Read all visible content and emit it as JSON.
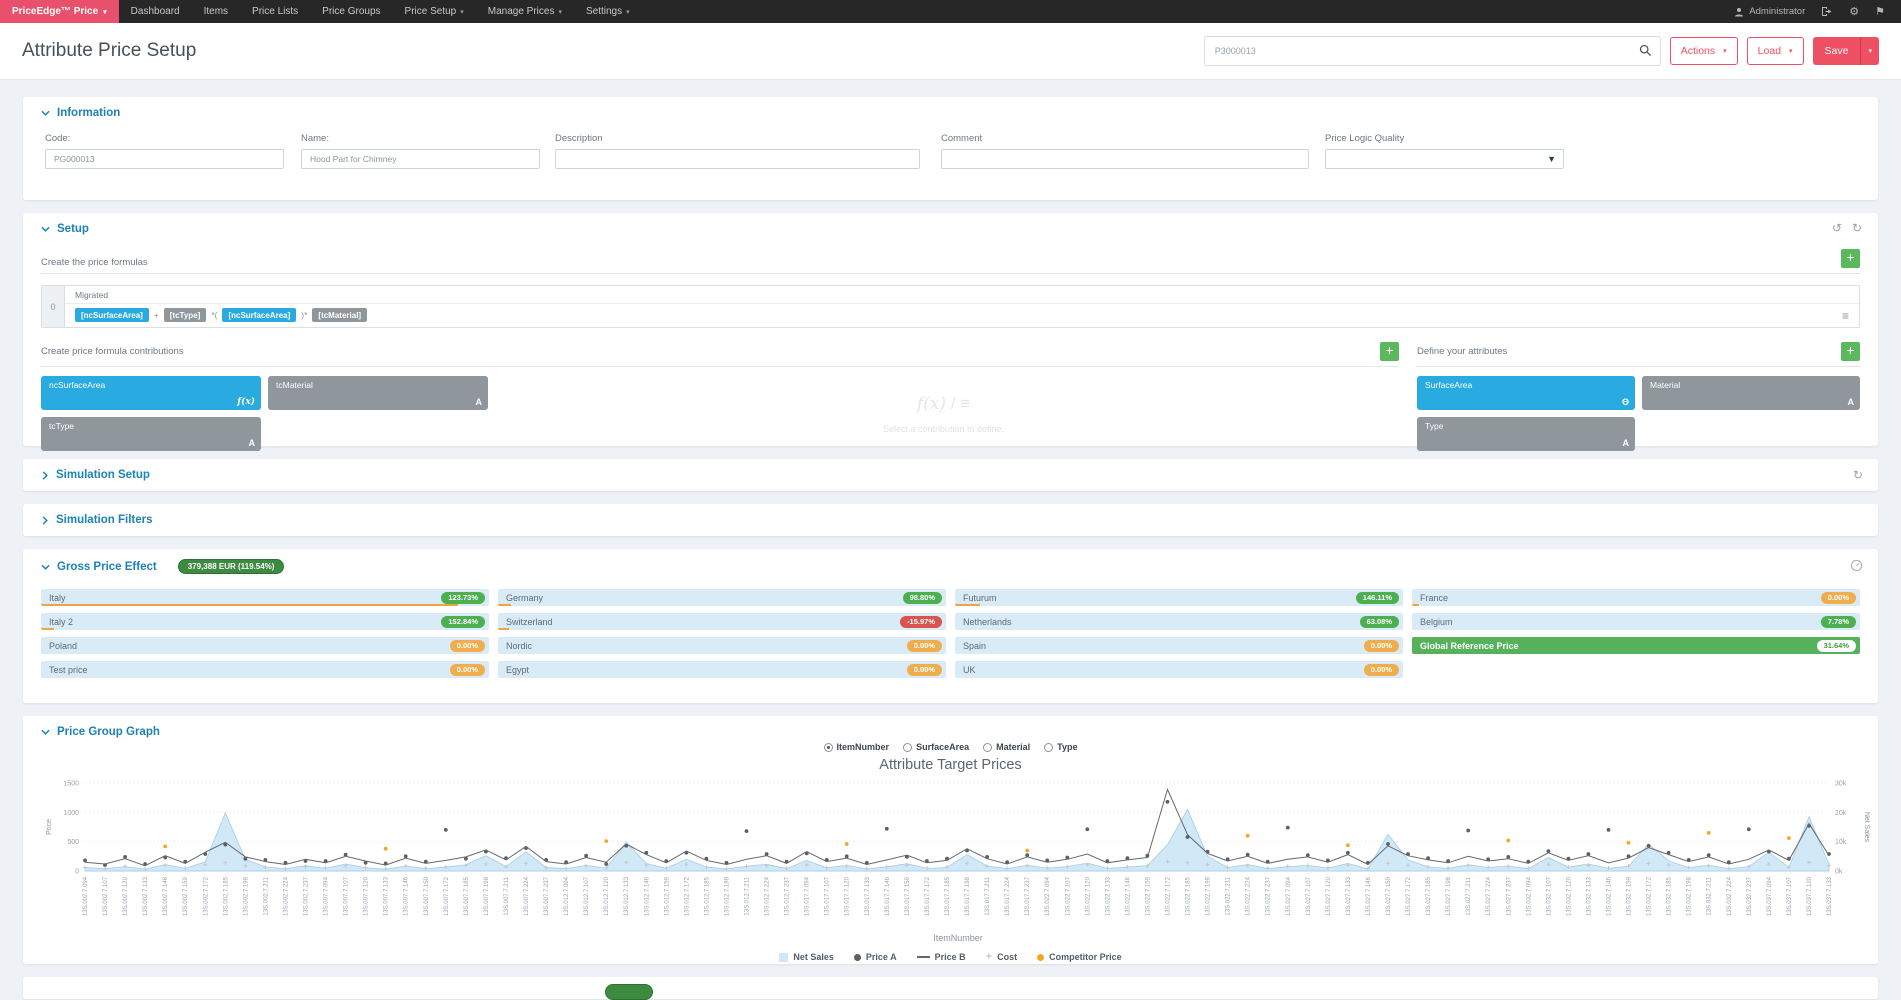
{
  "colors": {
    "accent": "#ee4f63",
    "brand": "#e8506b",
    "header_blue": "#1d82b5",
    "green": "#4caf50",
    "dark_green_badge": "#3d8b40",
    "orange": "#f0ad4e",
    "red": "#d9534f",
    "card_blue": "#29abe2",
    "card_gray": "#8f969c",
    "row_blue": "#d9ebf7",
    "global_green": "#56b25a",
    "bar_orange": "#f0a43f"
  },
  "navbar": {
    "brand": "PriceEdge™ Price",
    "items": [
      {
        "label": "Dashboard",
        "caret": false
      },
      {
        "label": "Items",
        "caret": false
      },
      {
        "label": "Price Lists",
        "caret": false
      },
      {
        "label": "Price Groups",
        "caret": false
      },
      {
        "label": "Price Setup",
        "caret": true
      },
      {
        "label": "Manage Prices",
        "caret": true
      },
      {
        "label": "Settings",
        "caret": true
      }
    ],
    "user": "Administrator"
  },
  "header": {
    "title": "Attribute Price Setup",
    "search_value": "P3000013",
    "actions_label": "Actions",
    "load_label": "Load",
    "save_label": "Save"
  },
  "information": {
    "title": "Information",
    "fields": [
      {
        "label": "Code:",
        "value": "PG000013",
        "type": "input"
      },
      {
        "label": "Name:",
        "value": "Hood Part for Chimney",
        "type": "input"
      },
      {
        "label": "Description",
        "value": "",
        "type": "input"
      },
      {
        "label": "Comment",
        "value": "",
        "type": "input"
      },
      {
        "label": "Price Logic Quality",
        "value": "",
        "type": "select"
      }
    ]
  },
  "setup": {
    "title": "Setup",
    "formulas_label": "Create the price formulas",
    "formula_index": "0",
    "formula_name": "Migrated",
    "formula_tokens": [
      {
        "kind": "chip",
        "style": "blue",
        "label": "[ncSurfaceArea]"
      },
      {
        "kind": "op",
        "label": "+"
      },
      {
        "kind": "chip",
        "style": "gray",
        "label": "[tcType]"
      },
      {
        "kind": "op",
        "label": "*("
      },
      {
        "kind": "chip",
        "style": "blue",
        "label": "[ncSurfaceArea]"
      },
      {
        "kind": "op",
        "label": ")*"
      },
      {
        "kind": "chip",
        "style": "gray",
        "label": "[tcMaterial]"
      }
    ],
    "contributions_label": "Create price formula contributions",
    "contribution_cards": [
      {
        "label": "ncSurfaceArea",
        "variant": "blue",
        "icon": "f(x)",
        "icon_name": "formula-icon"
      },
      {
        "label": "tcMaterial",
        "variant": "gray",
        "icon": "A",
        "icon_name": "text-attribute-icon"
      },
      {
        "label": "tcType",
        "variant": "gray",
        "icon": "A",
        "icon_name": "text-attribute-icon"
      }
    ],
    "definition_hint": "Select a contribution to define.",
    "definition_icons": "f(x) / ≡",
    "attributes_label": "Define your attributes",
    "attribute_cards": [
      {
        "label": "SurfaceArea",
        "variant": "blue",
        "icon": "Θ",
        "icon_name": "numeric-attribute-icon"
      },
      {
        "label": "Material",
        "variant": "gray",
        "icon": "A",
        "icon_name": "text-attribute-icon"
      },
      {
        "label": "Type",
        "variant": "gray",
        "icon": "A",
        "icon_name": "text-attribute-icon"
      }
    ]
  },
  "simulation_setup": {
    "title": "Simulation Setup"
  },
  "simulation_filters": {
    "title": "Simulation Filters"
  },
  "gross_price_effect": {
    "title": "Gross Price Effect",
    "total_badge": "379,388 EUR (119.54%)",
    "columns": [
      [
        {
          "name": "Italy",
          "badge": "123.73%",
          "tone": "green",
          "bar": 0.93
        },
        {
          "name": "Italy 2",
          "badge": "152.84%",
          "tone": "green",
          "bar": 0.03
        },
        {
          "name": "Poland",
          "badge": "0.00%",
          "tone": "orange",
          "bar": 0
        },
        {
          "name": "Test price",
          "badge": "0.00%",
          "tone": "orange",
          "bar": 0
        }
      ],
      [
        {
          "name": "Germany",
          "badge": "98.80%",
          "tone": "green",
          "bar": 0.03
        },
        {
          "name": "Switzerland",
          "badge": "-15.97%",
          "tone": "red",
          "bar": 0.025
        },
        {
          "name": "Nordic",
          "badge": "0.00%",
          "tone": "orange",
          "bar": 0
        },
        {
          "name": "Egypt",
          "badge": "0.00%",
          "tone": "orange",
          "bar": 0
        }
      ],
      [
        {
          "name": "Futurum",
          "badge": "146.11%",
          "tone": "green",
          "bar": 0.055
        },
        {
          "name": "Netherlands",
          "badge": "63.08%",
          "tone": "green",
          "bar": 0
        },
        {
          "name": "Spain",
          "badge": "0.00%",
          "tone": "orange",
          "bar": 0
        },
        {
          "name": "UK",
          "badge": "0.00%",
          "tone": "orange",
          "bar": 0
        }
      ],
      [
        {
          "name": "France",
          "badge": "0.00%",
          "tone": "orange",
          "bar": 0.015
        },
        {
          "name": "Belgium",
          "badge": "7.78%",
          "tone": "green",
          "bar": 0
        },
        {
          "name": "Global Reference Price",
          "badge": "31.64%",
          "tone": "global",
          "bar": 0
        }
      ]
    ]
  },
  "price_group_graph": {
    "title": "Price Group Graph",
    "radios": [
      {
        "label": "ItemNumber",
        "selected": true
      },
      {
        "label": "SurfaceArea",
        "selected": false
      },
      {
        "label": "Material",
        "selected": false
      },
      {
        "label": "Type",
        "selected": false
      }
    ],
    "chart_data": {
      "type": "line",
      "title": "Attribute Target Prices",
      "xlabel": "ItemNumber",
      "ylabel_left": "Price",
      "ylabel_right": "Net Sales",
      "ylim_left": [
        0,
        1500
      ],
      "ylim_right": [
        0,
        30000
      ],
      "yticks_left": [
        0,
        500,
        1000,
        1500
      ],
      "yticks_right": [
        "0k",
        "10k",
        "20k",
        "30k"
      ],
      "grid": true,
      "legend_position": "bottom",
      "categories": [
        "13S.002.7.094",
        "13S.002.7.107",
        "13S.002.7.120",
        "13S.002.7.133",
        "13S.002.7.146",
        "13S.002.7.159",
        "13S.002.7.172",
        "13S.002.7.185",
        "13S.002.7.198",
        "13S.002.7.211",
        "13S.002.7.224",
        "13S.002.7.237",
        "13S.007.7.094",
        "13S.007.7.107",
        "13S.007.7.120",
        "13S.007.7.133",
        "13S.007.7.146",
        "13S.007.7.159",
        "13S.007.7.172",
        "13S.007.7.185",
        "13S.007.7.198",
        "13S.007.7.211",
        "13S.007.7.224",
        "13S.007.7.237",
        "13S.012.7.094",
        "13S.012.7.107",
        "13S.012.7.120",
        "13S.012.7.133",
        "13S.012.7.146",
        "13S.012.7.159",
        "13S.012.7.172",
        "13S.012.7.185",
        "13S.012.7.198",
        "13S.012.7.211",
        "13S.012.7.224",
        "13S.012.7.237",
        "13S.017.7.094",
        "13S.017.7.107",
        "13S.017.7.120",
        "13S.017.7.133",
        "13S.017.7.146",
        "13S.017.7.159",
        "13S.017.7.172",
        "13S.017.7.185",
        "13S.017.7.198",
        "13S.017.7.211",
        "13S.017.7.224",
        "13S.017.7.237",
        "13S.022.7.094",
        "13S.022.7.107",
        "13S.022.7.120",
        "13S.022.7.133",
        "13S.022.7.146",
        "13S.022.7.159",
        "13S.022.7.172",
        "13S.022.7.185",
        "13S.022.7.198",
        "13S.022.7.211",
        "13S.022.7.224",
        "13S.022.7.237",
        "13S.027.7.094",
        "13S.027.7.107",
        "13S.027.7.120",
        "13S.027.7.133",
        "13S.027.7.146",
        "13S.027.7.159",
        "13S.027.7.172",
        "13S.027.7.185",
        "13S.027.7.198",
        "13S.027.7.211",
        "13S.027.7.224",
        "13S.027.7.237",
        "13S.032.7.094",
        "13S.032.7.107",
        "13S.032.7.120",
        "13S.032.7.133",
        "13S.032.7.146",
        "13S.032.7.159",
        "13S.032.7.172",
        "13S.032.7.185",
        "13S.032.7.198",
        "13S.032.7.211",
        "13S.032.7.224",
        "13S.032.7.237",
        "13S.037.7.094",
        "13S.037.7.107",
        "13S.037.7.120",
        "13S.037.7.133"
      ],
      "series": [
        {
          "name": "Net Sales",
          "type": "area",
          "axis": "right",
          "color": "#cfe7f6",
          "stroke": "#9fcce9",
          "values": [
            1200,
            800,
            1500,
            600,
            2200,
            900,
            3100,
            19800,
            4000,
            1400,
            700,
            1800,
            900,
            2400,
            1100,
            600,
            1700,
            800,
            1300,
            2100,
            5200,
            1500,
            6500,
            1200,
            800,
            1900,
            1000,
            9800,
            2600,
            900,
            4100,
            1300,
            700,
            1600,
            2300,
            800,
            3600,
            1100,
            1900,
            700,
            1400,
            2500,
            900,
            1200,
            5600,
            1700,
            800,
            2000,
            1000,
            1500,
            2700,
            900,
            1300,
            1800,
            9000,
            21000,
            5000,
            1200,
            2200,
            800,
            1500,
            1900,
            1000,
            2600,
            700,
            12500,
            3800,
            1400,
            900,
            2100,
            1200,
            1700,
            800,
            4600,
            1300,
            2400,
            900,
            1600,
            9200,
            3500,
            1100,
            2000,
            700,
            1500,
            6400,
            1200,
            18500,
            2300
          ]
        },
        {
          "name": "Price A",
          "type": "scatter",
          "axis": "left",
          "color": "#5a6065",
          "values": [
            180,
            100,
            240,
            120,
            230,
            160,
            290,
            450,
            210,
            190,
            140,
            170,
            170,
            280,
            140,
            130,
            250,
            160,
            700,
            210,
            330,
            220,
            390,
            190,
            150,
            260,
            120,
            430,
            310,
            170,
            310,
            210,
            140,
            680,
            290,
            160,
            300,
            190,
            250,
            140,
            720,
            240,
            170,
            210,
            350,
            240,
            150,
            270,
            180,
            230,
            710,
            170,
            220,
            260,
            1180,
            580,
            330,
            200,
            280,
            160,
            740,
            270,
            180,
            310,
            140,
            460,
            290,
            220,
            170,
            690,
            200,
            240,
            160,
            340,
            210,
            290,
            700,
            250,
            430,
            310,
            190,
            270,
            150,
            710,
            330,
            210,
            770,
            290
          ]
        },
        {
          "name": "Price B",
          "type": "line",
          "axis": "left",
          "color": "#63696e",
          "values": [
            150,
            120,
            210,
            90,
            260,
            130,
            320,
            490,
            240,
            160,
            110,
            200,
            140,
            250,
            170,
            100,
            220,
            130,
            180,
            240,
            360,
            190,
            420,
            160,
            120,
            230,
            150,
            460,
            280,
            140,
            340,
            180,
            110,
            200,
            260,
            130,
            330,
            160,
            220,
            110,
            190,
            270,
            140,
            180,
            380,
            210,
            120,
            240,
            150,
            200,
            290,
            140,
            190,
            230,
            1390,
            620,
            300,
            170,
            250,
            130,
            200,
            240,
            150,
            280,
            110,
            430,
            260,
            190,
            140,
            250,
            170,
            210,
            130,
            310,
            180,
            260,
            140,
            220,
            400,
            280,
            160,
            240,
            120,
            200,
            360,
            180,
            810,
            260
          ]
        },
        {
          "name": "Cost",
          "type": "scatter-plus",
          "axis": "left",
          "color": "#c3c9ce",
          "values": [
            60,
            45,
            80,
            35,
            95,
            50,
            110,
            140,
            90,
            65,
            40,
            75,
            55,
            90,
            60,
            38,
            85,
            48,
            70,
            95,
            120,
            72,
            130,
            58,
            44,
            88,
            52,
            150,
            100,
            50,
            115,
            66,
            40,
            78,
            92,
            48,
            105,
            58,
            84,
            42,
            72,
            98,
            52,
            68,
            125,
            80,
            44,
            90,
            56,
            76,
            108,
            50,
            70,
            88,
            160,
            140,
            110,
            62,
            94,
            48,
            78,
            92,
            56,
            104,
            40,
            130,
            98,
            70,
            50,
            94,
            62,
            82,
            46,
            112,
            68,
            96,
            52,
            84,
            128,
            104,
            58,
            90,
            42,
            76,
            118,
            64,
            145,
            95
          ]
        },
        {
          "name": "Competitor Price",
          "type": "scatter",
          "axis": "left",
          "color": "#f5a623",
          "values": [
            null,
            null,
            null,
            null,
            420,
            null,
            null,
            null,
            null,
            null,
            null,
            null,
            null,
            null,
            null,
            380,
            null,
            null,
            null,
            null,
            null,
            null,
            null,
            null,
            null,
            null,
            510,
            null,
            null,
            null,
            null,
            null,
            null,
            null,
            null,
            null,
            null,
            null,
            460,
            null,
            null,
            null,
            null,
            null,
            null,
            null,
            null,
            350,
            null,
            null,
            null,
            null,
            null,
            null,
            null,
            null,
            null,
            null,
            600,
            null,
            null,
            null,
            null,
            440,
            null,
            null,
            null,
            null,
            null,
            null,
            null,
            520,
            null,
            null,
            null,
            null,
            null,
            480,
            null,
            null,
            null,
            650,
            null,
            null,
            null,
            560,
            null,
            null
          ]
        }
      ]
    }
  }
}
